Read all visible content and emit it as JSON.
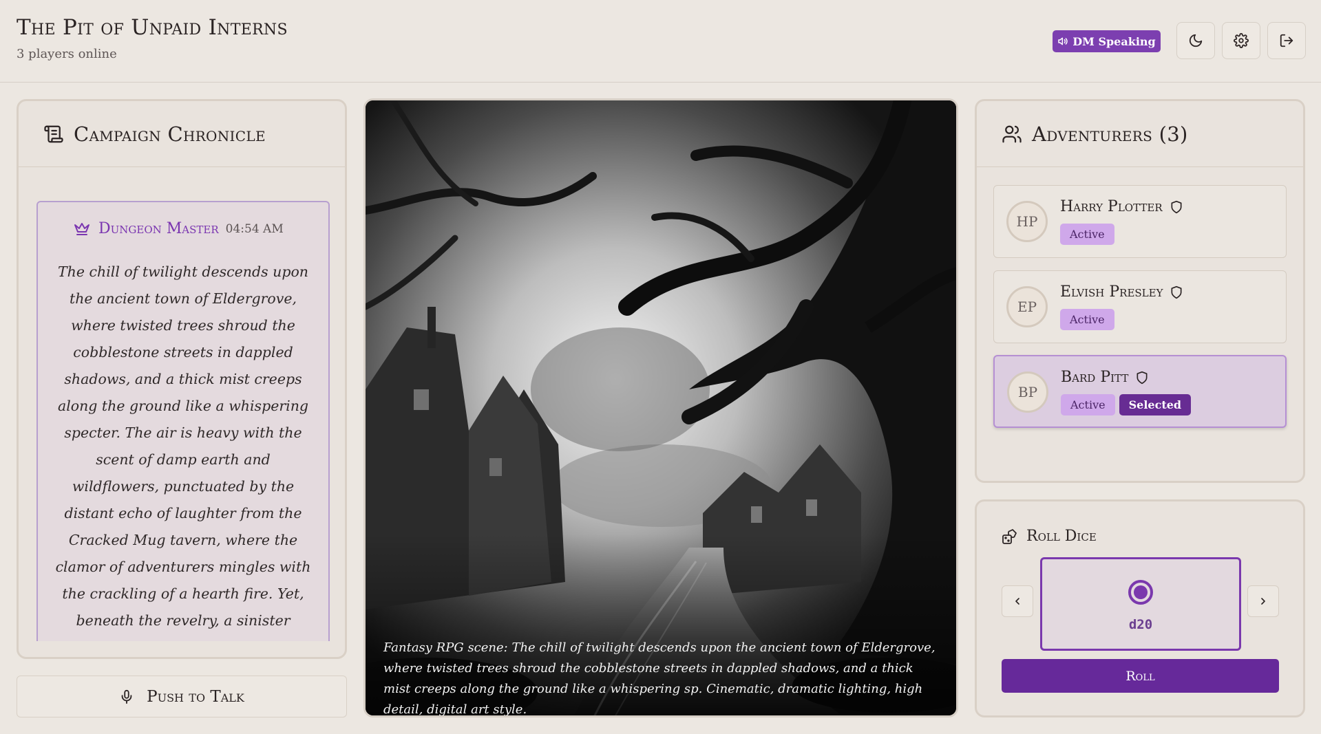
{
  "header": {
    "title": "The Pit of Unpaid Interns",
    "subtitle": "3 players online",
    "dm_badge": "DM Speaking",
    "icons": [
      "speaker-icon",
      "moon-icon",
      "gear-icon",
      "logout-icon"
    ]
  },
  "chronicle": {
    "title": "Campaign Chronicle",
    "message": {
      "author": "Dungeon Master",
      "time": "04:54 AM",
      "text": "The chill of twilight descends upon the ancient town of Eldergrove, where twisted trees shroud the cobblestone streets in dappled shadows, and a thick mist creeps along the ground like a whispering specter. The air is heavy with the scent of damp earth and wildflowers, punctuated by the distant echo of laughter from the Cracked Mug tavern, where the clamor of adventurers mingles with the crackling of a hearth fire. Yet, beneath the revelry, a sinister undercurrent flows; locals speak in hushed tones of flickering lights seen in the depths of the Forbidden Glen—lights that vanish into the thick canopy, leaving"
    }
  },
  "push_to_talk": "Push to Talk",
  "scene": {
    "caption": "Fantasy RPG scene: The chill of twilight descends upon the ancient town of Eldergrove, where twisted trees shroud the cobblestone streets in dappled shadows, and a thick mist creeps along the ground like a whispering sp. Cinematic, dramatic lighting, high detail, digital art style."
  },
  "adventurers": {
    "title": "Adventurers (3)",
    "players": [
      {
        "initials": "HP",
        "name": "Harry Plotter",
        "status": "Active"
      },
      {
        "initials": "EP",
        "name": "Elvish Presley",
        "status": "Active"
      },
      {
        "initials": "BP",
        "name": "Bard Pitt",
        "status": "Active",
        "selected_label": "Selected"
      }
    ]
  },
  "dice": {
    "title": "Roll Dice",
    "current": "d20",
    "roll_label": "Roll"
  },
  "colors": {
    "accent": "#7c3fb0",
    "accent_dark": "#66299a",
    "background": "#ece7e1"
  }
}
